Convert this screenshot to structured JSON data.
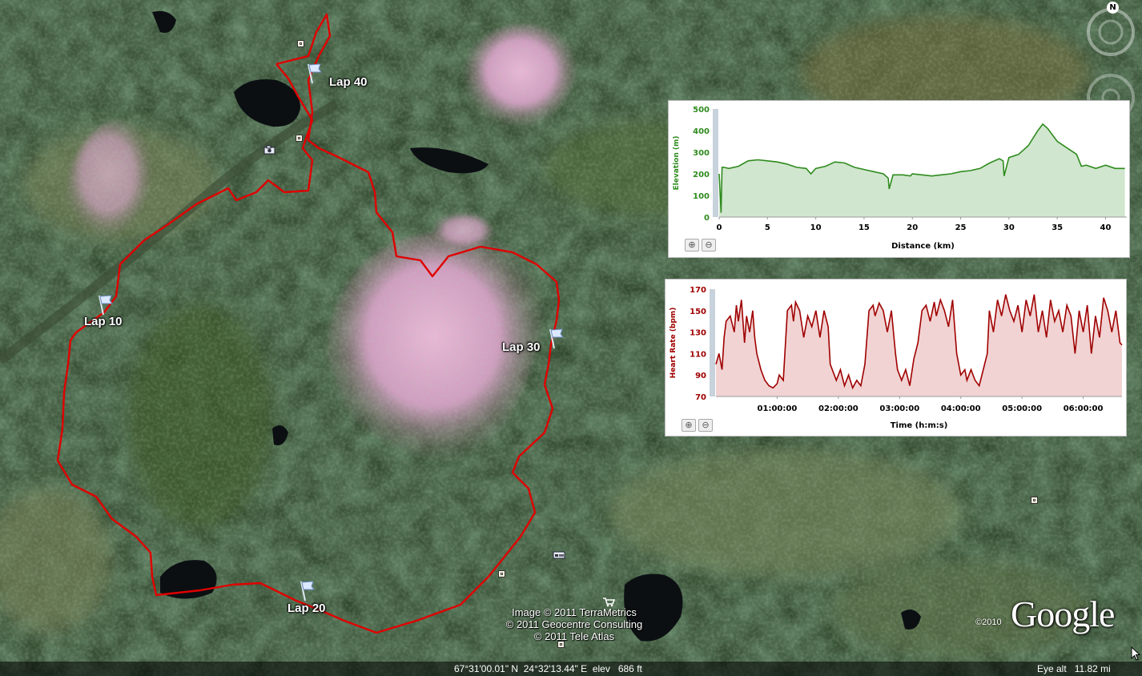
{
  "map": {
    "lap_markers": [
      {
        "label": "Lap 10"
      },
      {
        "label": "Lap 20"
      },
      {
        "label": "Lap 30"
      },
      {
        "label": "Lap 40"
      }
    ],
    "copyright_lines": [
      "Image © 2011 TerraMetrics",
      "© 2011 Geocentre Consulting",
      "© 2011 Tele Atlas"
    ],
    "logo_year": "©2010",
    "logo_text": "Google",
    "compass_letter": "N",
    "status": {
      "coordinates": "67°31'00.01\" N  24°32'13.44\" E  elev   686 ft",
      "eye_alt": "Eye alt   11.82 mi"
    },
    "colors": {
      "track": "#e00000",
      "elevation": "#2e8b1e",
      "heart_rate": "#a00000"
    }
  },
  "chart_data": [
    {
      "type": "area",
      "ylabel": "Elevation (m)",
      "xlabel": "Distance (km)",
      "xlim": [
        0,
        42.2
      ],
      "ylim": [
        0,
        500
      ],
      "x_ticks": [
        "0",
        "5",
        "10",
        "15",
        "20",
        "25",
        "30",
        "35",
        "40"
      ],
      "y_ticks": [
        "0",
        "100",
        "200",
        "300",
        "400",
        "500"
      ],
      "color": "#2e8b1e",
      "x": [
        0,
        0.2,
        0.3,
        0.5,
        1,
        2,
        3,
        4,
        5,
        6,
        7,
        8,
        9,
        9.5,
        10,
        11,
        12,
        13,
        14,
        15,
        16,
        17,
        17.5,
        17.6,
        18,
        19,
        19.8,
        20,
        21,
        22,
        23,
        24,
        25,
        26,
        27,
        28,
        29,
        29.4,
        29.5,
        30,
        31,
        32,
        33,
        33.5,
        34,
        35,
        36,
        37,
        37.5,
        38,
        39,
        40,
        41,
        42
      ],
      "y": [
        200,
        20,
        230,
        230,
        225,
        235,
        260,
        265,
        260,
        255,
        245,
        230,
        225,
        200,
        225,
        235,
        255,
        250,
        230,
        220,
        210,
        200,
        180,
        130,
        195,
        195,
        190,
        200,
        195,
        190,
        195,
        200,
        210,
        215,
        225,
        250,
        270,
        260,
        190,
        275,
        290,
        330,
        400,
        430,
        410,
        350,
        320,
        290,
        235,
        240,
        225,
        240,
        225,
        225
      ]
    },
    {
      "type": "line",
      "ylabel": "Heart Rate (bpm)",
      "xlabel": "Time (h:m:s)",
      "x_unit": "minutes",
      "xlim": [
        0,
        398
      ],
      "ylim": [
        70,
        170
      ],
      "x_ticks": [
        "01:00:00",
        "02:00:00",
        "03:00:00",
        "04:00:00",
        "05:00:00",
        "06:00:00"
      ],
      "y_ticks": [
        "70",
        "90",
        "110",
        "130",
        "150",
        "170"
      ],
      "color": "#a00000",
      "x": [
        0,
        3,
        6,
        8,
        10,
        14,
        18,
        20,
        22,
        25,
        28,
        30,
        33,
        36,
        38,
        40,
        44,
        48,
        52,
        56,
        60,
        62,
        66,
        70,
        74,
        76,
        78,
        82,
        86,
        90,
        94,
        98,
        102,
        106,
        110,
        112,
        116,
        118,
        122,
        126,
        130,
        134,
        138,
        142,
        146,
        150,
        154,
        156,
        160,
        164,
        168,
        172,
        176,
        178,
        182,
        186,
        190,
        194,
        198,
        202,
        206,
        210,
        214,
        216,
        220,
        224,
        228,
        232,
        236,
        240,
        244,
        246,
        250,
        254,
        258,
        262,
        266,
        268,
        272,
        276,
        280,
        284,
        288,
        292,
        296,
        300,
        304,
        308,
        312,
        316,
        320,
        324,
        328,
        332,
        336,
        340,
        344,
        348,
        352,
        356,
        360,
        364,
        368,
        372,
        376,
        380,
        384,
        388,
        392,
        396,
        398
      ],
      "y": [
        100,
        110,
        95,
        125,
        140,
        145,
        130,
        155,
        140,
        160,
        120,
        145,
        130,
        150,
        125,
        110,
        95,
        85,
        80,
        78,
        82,
        90,
        85,
        150,
        155,
        140,
        158,
        150,
        125,
        145,
        135,
        150,
        125,
        150,
        135,
        100,
        90,
        85,
        95,
        80,
        90,
        78,
        85,
        80,
        100,
        150,
        155,
        145,
        157,
        150,
        130,
        150,
        110,
        95,
        85,
        95,
        80,
        105,
        120,
        150,
        155,
        140,
        158,
        145,
        160,
        150,
        135,
        160,
        110,
        90,
        95,
        85,
        95,
        85,
        80,
        95,
        110,
        150,
        130,
        160,
        145,
        165,
        150,
        140,
        155,
        130,
        160,
        145,
        165,
        130,
        150,
        125,
        160,
        140,
        150,
        130,
        155,
        145,
        110,
        150,
        130,
        155,
        110,
        145,
        125,
        162,
        150,
        130,
        150,
        120,
        118
      ]
    }
  ]
}
